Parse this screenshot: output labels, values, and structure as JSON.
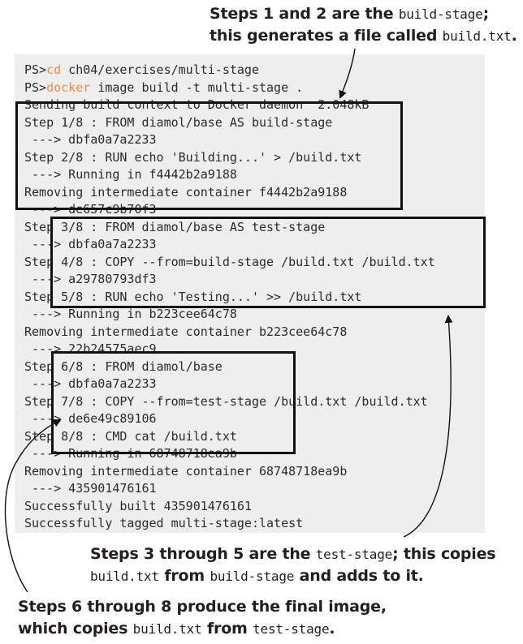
{
  "callouts": {
    "top": {
      "l1_text": "Steps 1 and 2 are the ",
      "l1_code": "build-stage",
      "l1_end": ";",
      "l2_text": "this generates a file called ",
      "l2_code": "build.txt",
      "l2_end": "."
    },
    "middle": {
      "l1_text": "Steps 3 through 5 are the ",
      "l1_code": "test-stage",
      "l1_end": "; this copies",
      "l2_code1": "build.txt",
      "l2_mid": " from ",
      "l2_code2": "build-stage",
      "l2_end": " and adds to it."
    },
    "bottom": {
      "l1_text": "Steps 6 through 8 produce the final image,",
      "l2_text": "which copies ",
      "l2_code1": "build.txt",
      "l2_mid": " from ",
      "l2_code2": "test-stage",
      "l2_end": "."
    }
  },
  "terminal": {
    "prompt1": {
      "ps": "PS>",
      "cmd": "cd",
      "rest": " ch04/exercises/multi-stage"
    },
    "prompt2": {
      "ps": "PS>",
      "cmd": "docker",
      "rest": " image build -t multi-stage ."
    },
    "lines": [
      "Sending build context to Docker daemon  2.048kB",
      "Step 1/8 : FROM diamol/base AS build-stage",
      " ---> dbfa0a7a2233",
      "Step 2/8 : RUN echo 'Building...' > /build.txt",
      " ---> Running in f4442b2a9188",
      "Removing intermediate container f4442b2a9188",
      " ---> de657c9b70f3",
      "Step 3/8 : FROM diamol/base AS test-stage",
      " ---> dbfa0a7a2233",
      "Step 4/8 : COPY --from=build-stage /build.txt /build.txt",
      " ---> a29780793df3",
      "Step 5/8 : RUN echo 'Testing...' >> /build.txt",
      " ---> Running in b223cee64c78",
      "Removing intermediate container b223cee64c78",
      " ---> 22b24575aec9",
      "Step 6/8 : FROM diamol/base",
      " ---> dbfa0a7a2233",
      "Step 7/8 : COPY --from=test-stage /build.txt /build.txt",
      " ---> de6e49c89106",
      "Step 8/8 : CMD cat /build.txt",
      " ---> Running in 68748718ea9b",
      "Removing intermediate container 68748718ea9b",
      " ---> 435901476161",
      "Successfully built 435901476161",
      "Successfully tagged multi-stage:latest"
    ]
  }
}
